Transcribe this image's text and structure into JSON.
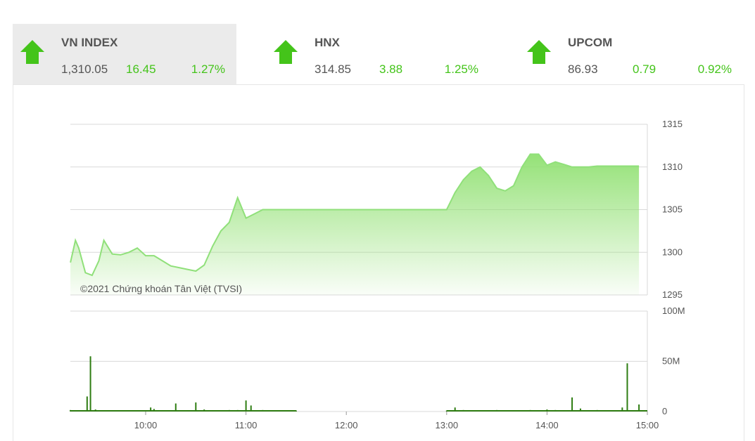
{
  "indices": [
    {
      "name": "VN INDEX",
      "price": "1,310.05",
      "change": "16.45",
      "percent": "1.27%",
      "direction": "up",
      "active": true
    },
    {
      "name": "HNX",
      "price": "314.85",
      "change": "3.88",
      "percent": "1.25%",
      "direction": "up",
      "active": false
    },
    {
      "name": "UPCOM",
      "price": "86.93",
      "change": "0.79",
      "percent": "0.92%",
      "direction": "up",
      "active": false
    }
  ],
  "colors": {
    "up": "#44c41a",
    "line": "#90e07a",
    "volume": "#2e7d12",
    "grid": "#d9d9d9"
  },
  "chart_data": {
    "type": "area",
    "credit": "©2021 Chứng khoán Tân Việt (TVSI)",
    "x_ticks": [
      "10:00",
      "11:00",
      "12:00",
      "13:00",
      "14:00",
      "15:00"
    ],
    "y_ticks": [
      "1315",
      "1310",
      "1305",
      "1300",
      "1295"
    ],
    "ylim": [
      1295,
      1315
    ],
    "price_series": {
      "x": [
        "09:15",
        "09:18",
        "09:20",
        "09:24",
        "09:28",
        "09:32",
        "09:35",
        "09:40",
        "09:45",
        "09:50",
        "09:55",
        "10:00",
        "10:05",
        "10:10",
        "10:15",
        "10:20",
        "10:25",
        "10:30",
        "10:35",
        "10:40",
        "10:45",
        "10:50",
        "10:55",
        "11:00",
        "11:05",
        "11:10",
        "11:15",
        "11:20",
        "11:25",
        "11:30",
        "13:00",
        "13:05",
        "13:10",
        "13:15",
        "13:20",
        "13:25",
        "13:30",
        "13:35",
        "13:40",
        "13:45",
        "13:50",
        "13:55",
        "14:00",
        "14:05",
        "14:10",
        "14:15",
        "14:20",
        "14:25",
        "14:30",
        "14:35",
        "14:40",
        "14:45",
        "14:50",
        "14:55"
      ],
      "y": [
        1298.8,
        1301.4,
        1300.5,
        1297.6,
        1297.3,
        1299.0,
        1301.4,
        1299.8,
        1299.7,
        1300.0,
        1300.5,
        1299.6,
        1299.6,
        1299.0,
        1298.4,
        1298.2,
        1298.0,
        1297.8,
        1298.5,
        1300.7,
        1302.5,
        1303.5,
        1306.4,
        1304.0,
        1304.5,
        1305.0,
        1305.0,
        1305.0,
        1305.0,
        1305.0,
        1305.0,
        1307.0,
        1308.5,
        1309.5,
        1310.0,
        1309.0,
        1307.5,
        1307.2,
        1307.8,
        1310.0,
        1311.5,
        1311.5,
        1310.2,
        1310.6,
        1310.3,
        1310.0,
        1310.0,
        1310.0,
        1310.1,
        1310.1,
        1310.1,
        1310.1,
        1310.1,
        1310.1
      ]
    },
    "volume_series": {
      "ylim": [
        0,
        100
      ],
      "y_ticks": [
        "100M",
        "50M",
        "0"
      ],
      "x": [
        "09:15",
        "09:17",
        "09:25",
        "09:27",
        "09:30",
        "10:00",
        "10:03",
        "10:05",
        "10:10",
        "10:18",
        "10:25",
        "10:30",
        "10:35",
        "10:40",
        "10:50",
        "10:55",
        "11:00",
        "11:03",
        "11:10",
        "11:20",
        "11:30",
        "13:00",
        "13:05",
        "13:10",
        "13:20",
        "13:30",
        "13:40",
        "13:50",
        "14:00",
        "14:05",
        "14:10",
        "14:15",
        "14:20",
        "14:25",
        "14:30",
        "14:35",
        "14:40",
        "14:45",
        "14:48",
        "14:55"
      ],
      "y": [
        1.5,
        1.0,
        15.0,
        55.0,
        2.0,
        1.0,
        4.0,
        2.5,
        1.0,
        8.0,
        1.0,
        9.0,
        2.0,
        1.0,
        1.5,
        1.5,
        11.0,
        6.0,
        1.5,
        1.0,
        1.0,
        1.0,
        4.0,
        1.5,
        1.0,
        1.5,
        1.0,
        1.5,
        2.0,
        1.5,
        1.0,
        14.0,
        3.0,
        1.0,
        1.5,
        1.0,
        1.0,
        4.0,
        48.0,
        7.0
      ]
    }
  }
}
